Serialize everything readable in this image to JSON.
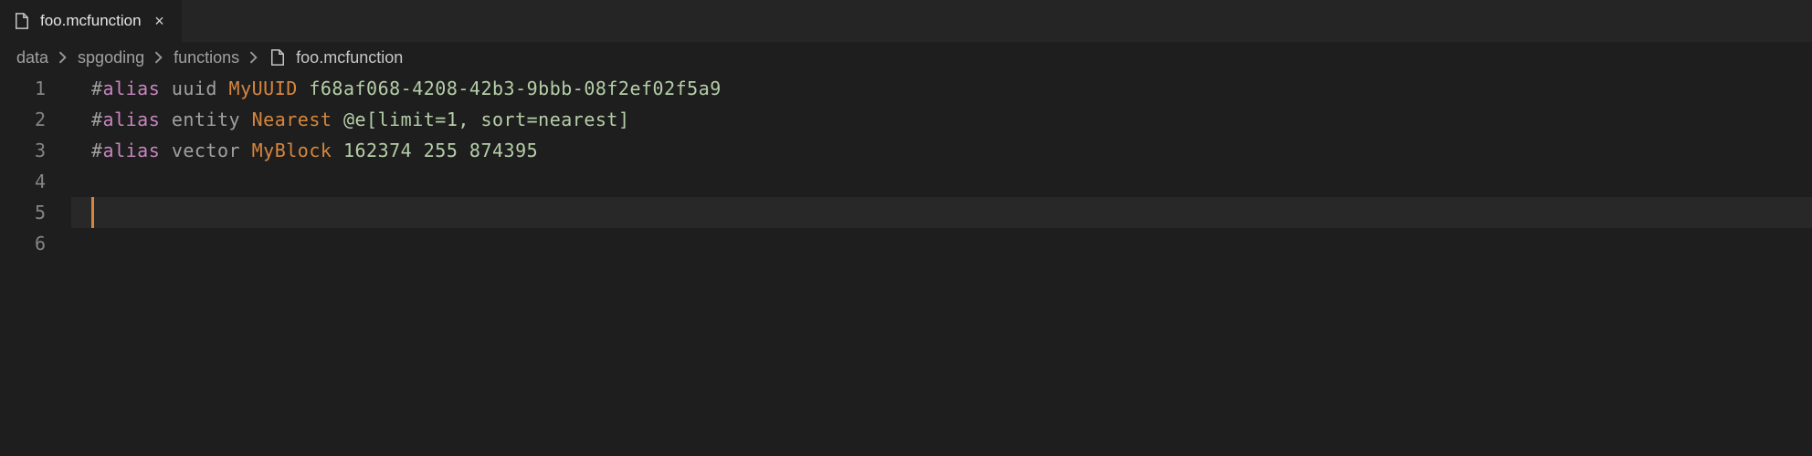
{
  "tab": {
    "filename": "foo.mcfunction",
    "close_label": "×"
  },
  "breadcrumb": {
    "seg1": "data",
    "seg2": "spgoding",
    "seg3": "functions",
    "seg4": "foo.mcfunction"
  },
  "icons": {
    "file": "file-icon",
    "chevron": "›"
  },
  "editor": {
    "line_numbers": [
      "1",
      "2",
      "3",
      "4",
      "5",
      "6"
    ],
    "current_line_index": 4,
    "lines": [
      {
        "hash": "#",
        "kw": "alias",
        "sp1": " ",
        "type": "uuid",
        "sp2": " ",
        "name": "MyUUID",
        "sp3": " ",
        "value": "f68af068-4208-42b3-9bbb-08f2ef02f5a9"
      },
      {
        "hash": "#",
        "kw": "alias",
        "sp1": " ",
        "type": "entity",
        "sp2": " ",
        "name": "Nearest",
        "sp3": " ",
        "value": "@e[limit=1, sort=nearest]"
      },
      {
        "hash": "#",
        "kw": "alias",
        "sp1": " ",
        "type": "vector",
        "sp2": " ",
        "name": "MyBlock",
        "sp3": " ",
        "value": "162374 255 874395"
      },
      {
        "empty": ""
      },
      {
        "empty": ""
      },
      {
        "empty": ""
      }
    ]
  }
}
